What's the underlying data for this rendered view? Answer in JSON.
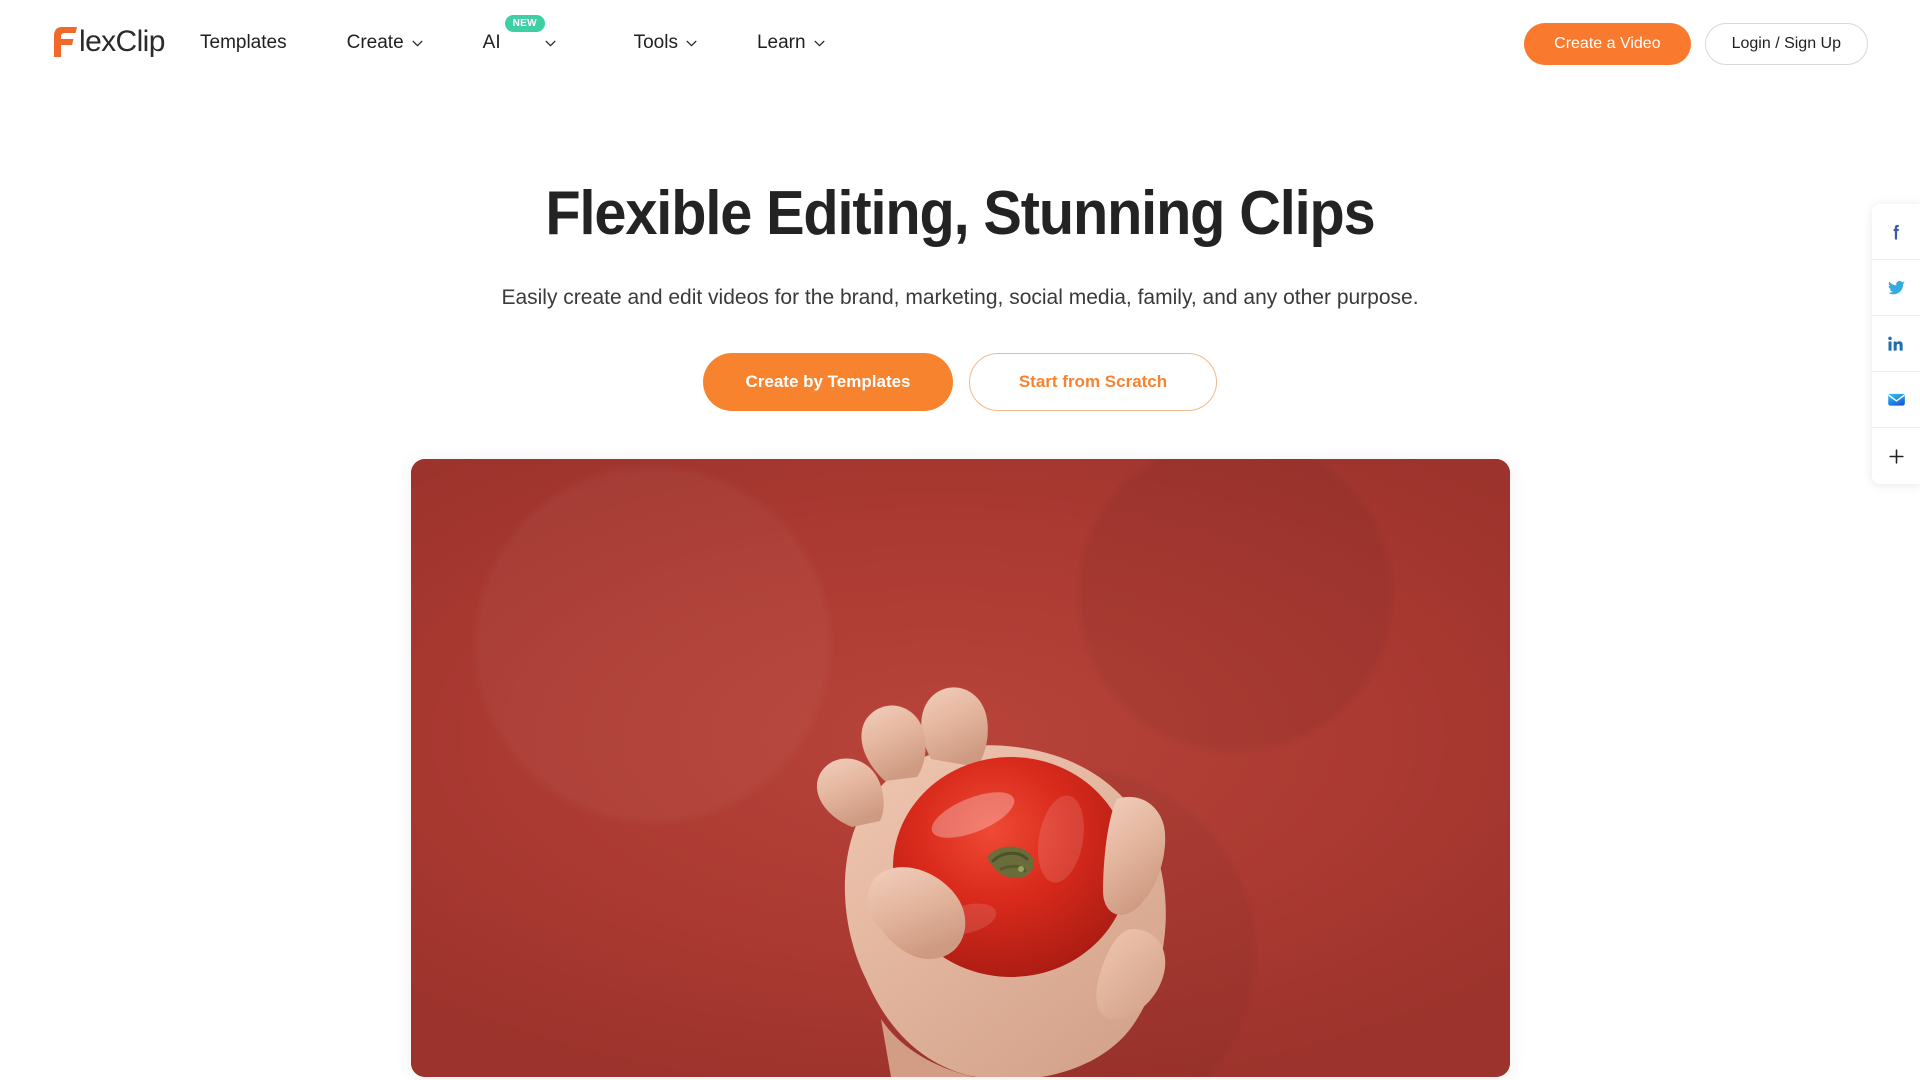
{
  "brand": {
    "logo_text": "lexClip",
    "logo_mark": "flexclip-f-logo",
    "accent_color": "#f8832f",
    "logo_text_color": "#2b2b2b"
  },
  "header": {
    "nav": [
      {
        "label": "Templates",
        "has_dropdown": false,
        "badge": null,
        "icon": null
      },
      {
        "label": "Create",
        "has_dropdown": true,
        "badge": null,
        "icon": "chevron-down-icon"
      },
      {
        "label": "AI",
        "has_dropdown": true,
        "badge": "NEW",
        "icon": "chevron-down-icon"
      },
      {
        "label": "Tools",
        "has_dropdown": true,
        "badge": null,
        "icon": "chevron-down-icon"
      },
      {
        "label": "Learn",
        "has_dropdown": true,
        "badge": null,
        "icon": "chevron-down-icon"
      }
    ],
    "badge_color": "#3ecfa4",
    "create_video_label": "Create a Video",
    "login_label": "Login / Sign Up"
  },
  "hero": {
    "headline": "Flexible Editing, Stunning Clips",
    "subheadline": "Easily create and edit videos for the brand, marketing, social media, family, and any other purpose.",
    "primary_cta": "Create by Templates",
    "secondary_cta": "Start from Scratch",
    "headline_color": "#232323",
    "primary_cta_color": "#f8832f"
  },
  "video_preview": {
    "description": "hand holding a red tomato on a red background",
    "background_color": "#ad3b33",
    "tomato_color": "#d42b1e"
  },
  "social_share": {
    "items": [
      {
        "name": "facebook",
        "glyph": "f",
        "color": "#3b5ba9"
      },
      {
        "name": "twitter",
        "glyph": "twitter-bird",
        "color": "#36a9e0"
      },
      {
        "name": "linkedin",
        "glyph": "in",
        "color": "#1c6fb0"
      },
      {
        "name": "email",
        "glyph": "envelope",
        "color": "#1a7fe8"
      },
      {
        "name": "more",
        "glyph": "+",
        "color": "#222222"
      }
    ]
  }
}
